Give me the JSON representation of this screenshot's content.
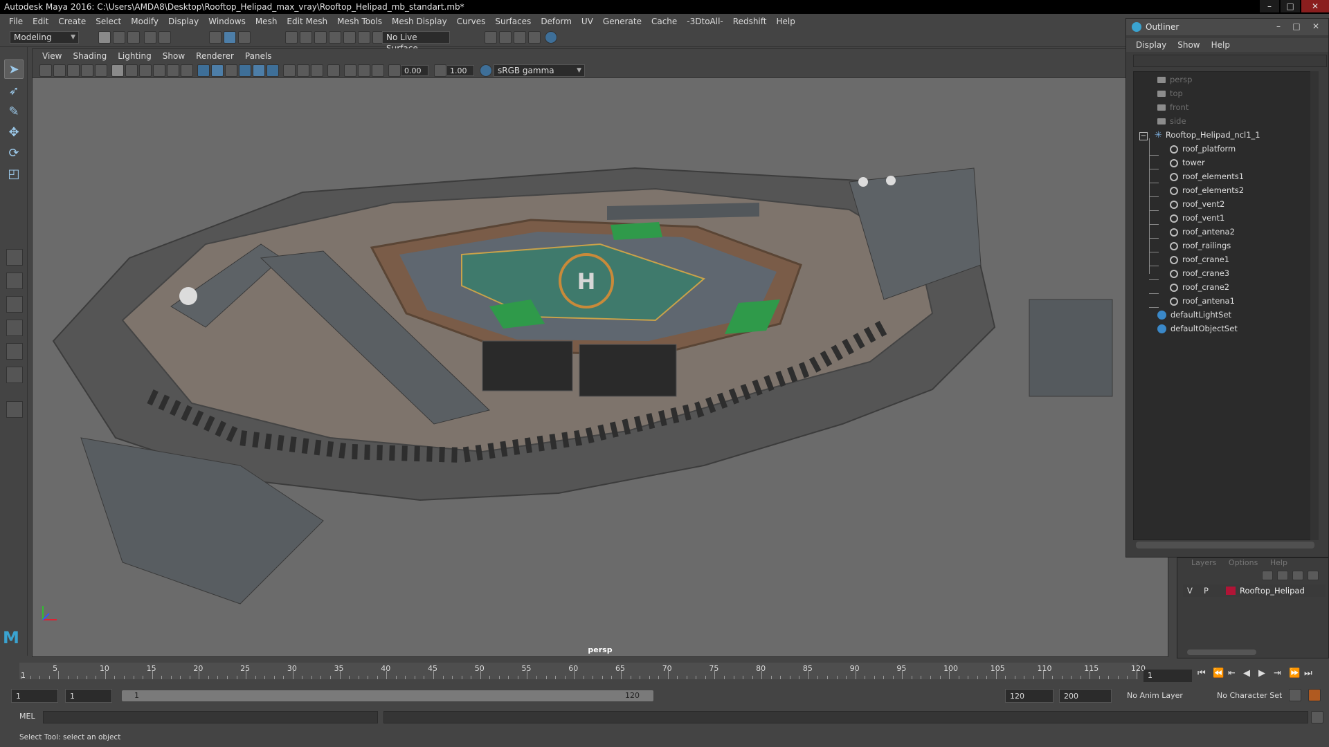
{
  "window": {
    "title": "Autodesk Maya 2016: C:\\Users\\AMDA8\\Desktop\\Rooftop_Helipad_max_vray\\Rooftop_Helipad_mb_standart.mb*"
  },
  "menubar": [
    "File",
    "Edit",
    "Create",
    "Select",
    "Modify",
    "Display",
    "Windows",
    "Mesh",
    "Edit Mesh",
    "Mesh Tools",
    "Mesh Display",
    "Curves",
    "Surfaces",
    "Deform",
    "UV",
    "Generate",
    "Cache",
    "-3DtoAll-",
    "Redshift",
    "Help"
  ],
  "statusline": {
    "mode": "Modeling",
    "live_surface": "No Live Surface"
  },
  "viewport": {
    "menu": [
      "View",
      "Shading",
      "Lighting",
      "Show",
      "Renderer",
      "Panels"
    ],
    "exposure": "0.00",
    "gamma": "1.00",
    "color_space": "sRGB gamma",
    "camera_label": "persp"
  },
  "outliner": {
    "title": "Outliner",
    "menu": [
      "Display",
      "Show",
      "Help"
    ],
    "cameras": [
      "persp",
      "top",
      "front",
      "side"
    ],
    "group": "Rooftop_Helipad_ncl1_1",
    "meshes": [
      "roof_platform",
      "tower",
      "roof_elements1",
      "roof_elements2",
      "roof_vent2",
      "roof_vent1",
      "roof_antena2",
      "roof_railings",
      "roof_crane1",
      "roof_crane3",
      "roof_crane2",
      "roof_antena1"
    ],
    "sets": [
      "defaultLightSet",
      "defaultObjectSet"
    ]
  },
  "layers": {
    "menu": [
      "Layers",
      "Options",
      "Help"
    ],
    "row": {
      "v": "V",
      "p": "P",
      "name": "Rooftop_Helipad",
      "color": "#b01436"
    }
  },
  "timeline": {
    "ticks": [
      "5",
      "10",
      "15",
      "20",
      "25",
      "30",
      "35",
      "40",
      "45",
      "50",
      "55",
      "60",
      "65",
      "70",
      "75",
      "80",
      "85",
      "90",
      "95",
      "100",
      "105",
      "110",
      "115",
      "120"
    ],
    "current_frame": "1",
    "start_marker": "1"
  },
  "range": {
    "start": "1",
    "anim_start": "1",
    "slider_start": "1",
    "slider_end": "120",
    "anim_end": "120",
    "end": "200",
    "anim_layer": "No Anim Layer",
    "character_set": "No Character Set"
  },
  "cmdline": {
    "label": "MEL"
  },
  "helpline": {
    "text": "Select Tool: select an object"
  }
}
